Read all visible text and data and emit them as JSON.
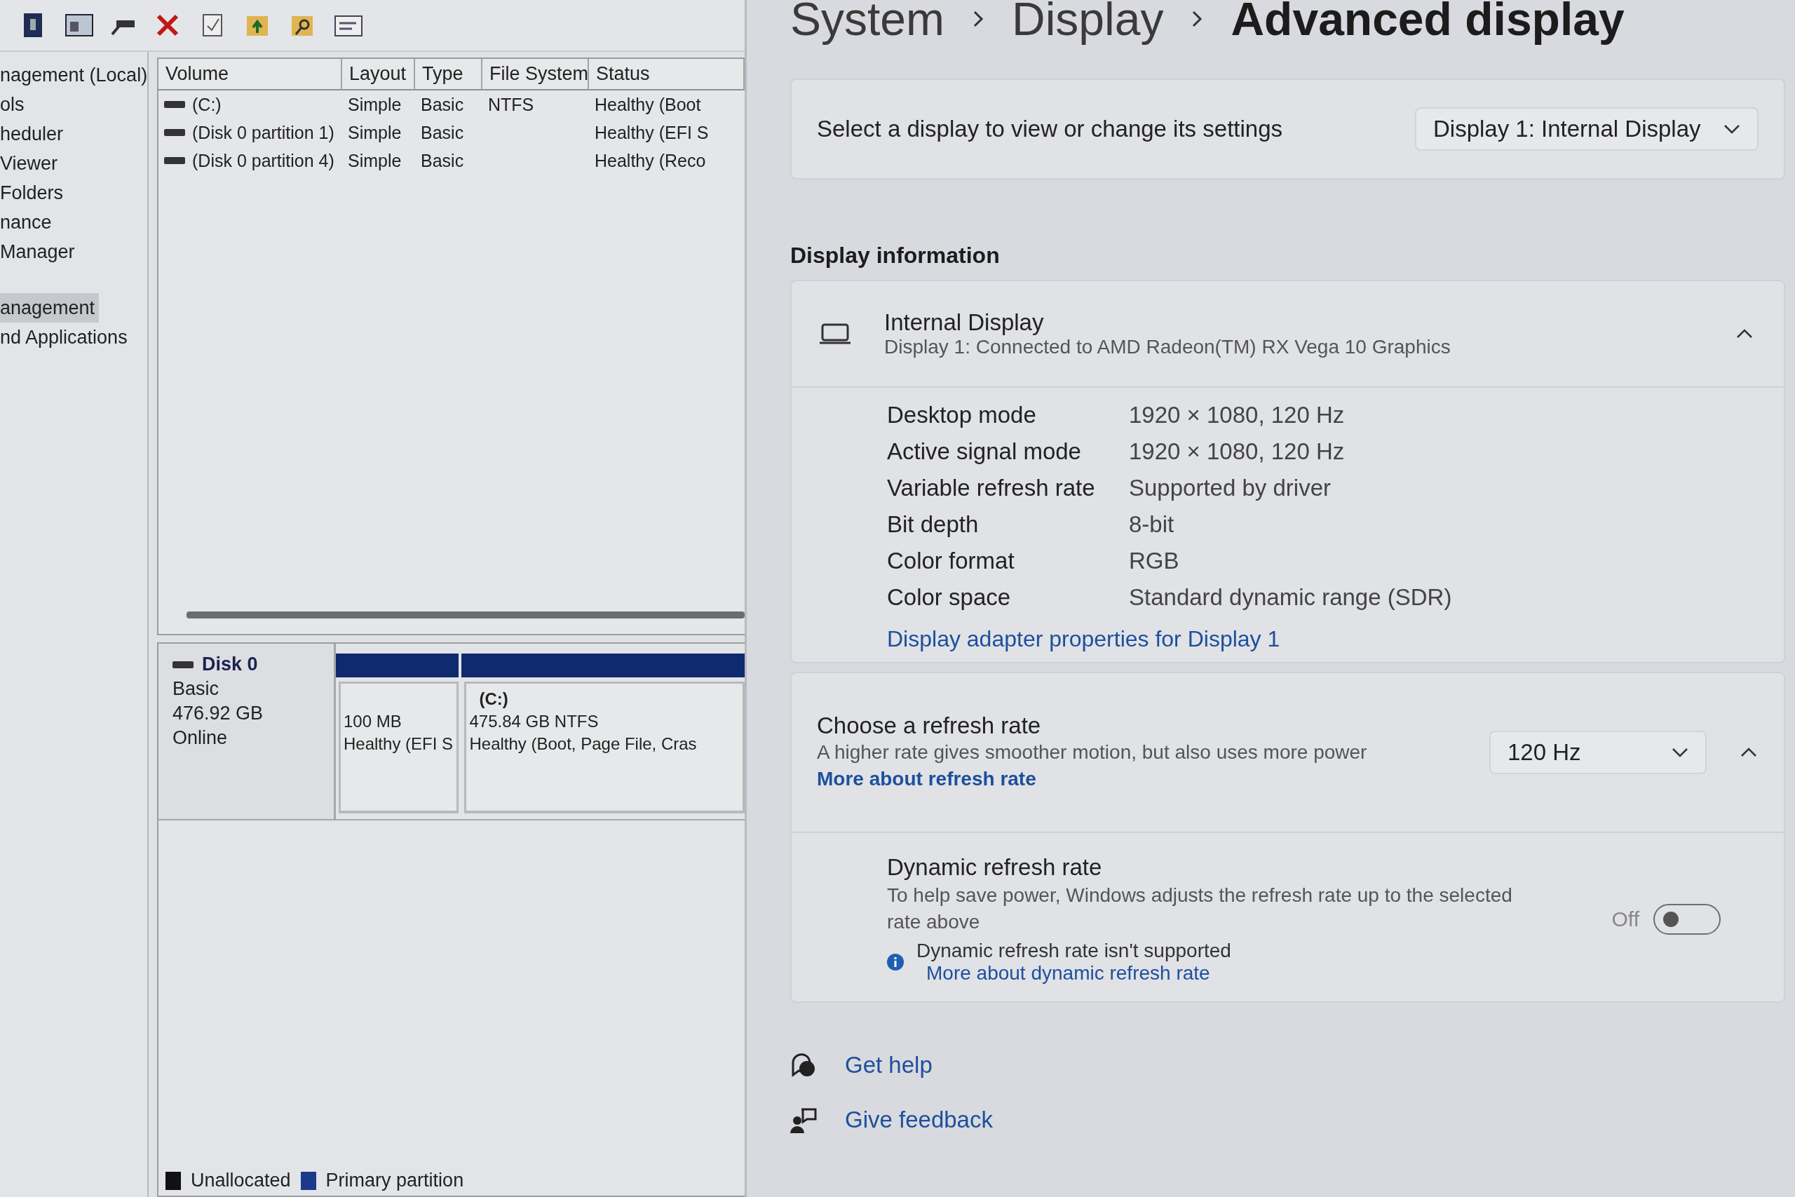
{
  "console_tree": {
    "items": [
      {
        "label": "nagement (Local)",
        "selected": false
      },
      {
        "label": "ols",
        "selected": false
      },
      {
        "label": "heduler",
        "selected": false
      },
      {
        "label": "Viewer",
        "selected": false
      },
      {
        "label": "Folders",
        "selected": false
      },
      {
        "label": "nance",
        "selected": false
      },
      {
        "label": "Manager",
        "selected": false
      },
      {
        "label": "anagement",
        "selected": true
      },
      {
        "label": "nd Applications",
        "selected": false
      }
    ]
  },
  "volume_table": {
    "columns": [
      "Volume",
      "Layout",
      "Type",
      "File System",
      "Status"
    ],
    "rows": [
      {
        "cells": [
          "(C:)",
          "Simple",
          "Basic",
          "NTFS",
          "Healthy (Boot"
        ]
      },
      {
        "cells": [
          "(Disk 0 partition 1)",
          "Simple",
          "Basic",
          "",
          "Healthy (EFI S"
        ]
      },
      {
        "cells": [
          "(Disk 0 partition 4)",
          "Simple",
          "Basic",
          "",
          "Healthy (Reco"
        ]
      }
    ]
  },
  "disk_map": {
    "disk": {
      "name": "Disk 0",
      "type": "Basic",
      "size": "476.92 GB",
      "status": "Online"
    },
    "partitions": [
      {
        "size": "100 MB",
        "status": "Healthy (EFI S"
      },
      {
        "title": "(C:)",
        "size": "475.84 GB NTFS",
        "status": "Healthy (Boot, Page File, Cras"
      }
    ],
    "legend": [
      {
        "label": "Unallocated",
        "color": "#111111"
      },
      {
        "label": "Primary partition",
        "color": "#1c3a8c"
      }
    ]
  },
  "settings": {
    "breadcrumb": [
      "System",
      "Display",
      "Advanced display"
    ],
    "select_display": {
      "label": "Select a display to view or change its settings",
      "value": "Display 1: Internal Display"
    },
    "section_title": "Display information",
    "display_info": {
      "name": "Internal Display",
      "subtitle": "Display 1: Connected to AMD Radeon(TM) RX Vega 10 Graphics",
      "expanded": true,
      "specs": [
        {
          "label": "Desktop mode",
          "value": "1920 × 1080, 120 Hz"
        },
        {
          "label": "Active signal mode",
          "value": "1920 × 1080, 120 Hz"
        },
        {
          "label": "Variable refresh rate",
          "value": "Supported by driver"
        },
        {
          "label": "Bit depth",
          "value": "8-bit"
        },
        {
          "label": "Color format",
          "value": "RGB"
        },
        {
          "label": "Color space",
          "value": "Standard dynamic range (SDR)"
        }
      ],
      "link": "Display adapter properties for Display 1"
    },
    "refresh_rate": {
      "title": "Choose a refresh rate",
      "description": "A higher rate gives smoother motion, but also uses more power",
      "link": "More about refresh rate",
      "value": "120 Hz",
      "expanded": true,
      "dynamic": {
        "title": "Dynamic refresh rate",
        "description": "To help save power, Windows adjusts the refresh rate up to the selected rate above",
        "state_label": "Off",
        "on": false,
        "notice": "Dynamic refresh rate isn't supported",
        "notice_link": "More about dynamic refresh rate"
      }
    },
    "footer_links": [
      "Get help",
      "Give feedback"
    ]
  }
}
